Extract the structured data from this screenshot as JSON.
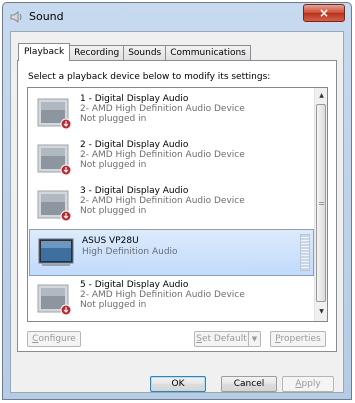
{
  "window": {
    "title": "Sound",
    "close_label": "×"
  },
  "tabs": [
    {
      "label": "Playback",
      "active": true
    },
    {
      "label": "Recording",
      "active": false
    },
    {
      "label": "Sounds",
      "active": false
    },
    {
      "label": "Communications",
      "active": false
    }
  ],
  "instruction": "Select a playback device below to modify its settings:",
  "devices": [
    {
      "name": "1 - Digital Display Audio",
      "description": "2- AMD High Definition Audio Device",
      "status": "Not plugged in",
      "icon": "speaker-unplugged-icon",
      "selected": false
    },
    {
      "name": "2 - Digital Display Audio",
      "description": "2- AMD High Definition Audio Device",
      "status": "Not plugged in",
      "icon": "speaker-unplugged-icon",
      "selected": false
    },
    {
      "name": "3 - Digital Display Audio",
      "description": "2- AMD High Definition Audio Device",
      "status": "Not plugged in",
      "icon": "speaker-unplugged-icon",
      "selected": false
    },
    {
      "name": "ASUS VP28U",
      "description": "High Definition Audio",
      "status": "",
      "icon": "monitor-icon",
      "selected": true
    },
    {
      "name": "5 - Digital Display Audio",
      "description": "2- AMD High Definition Audio Device",
      "status": "Not plugged in",
      "icon": "speaker-unplugged-icon",
      "selected": false
    }
  ],
  "buttons": {
    "configure_first": "C",
    "configure_rest": "onfigure",
    "set_default_first": "S",
    "set_default_rest": "et Default",
    "properties_first": "P",
    "properties_rest": "roperties",
    "ok": "OK",
    "cancel": "Cancel",
    "apply_first": "A",
    "apply_rest": "pply"
  },
  "colors": {
    "selection_border": "#7da2ce",
    "close_button": "#c9462f",
    "disabled_text": "#9a9a9a"
  }
}
